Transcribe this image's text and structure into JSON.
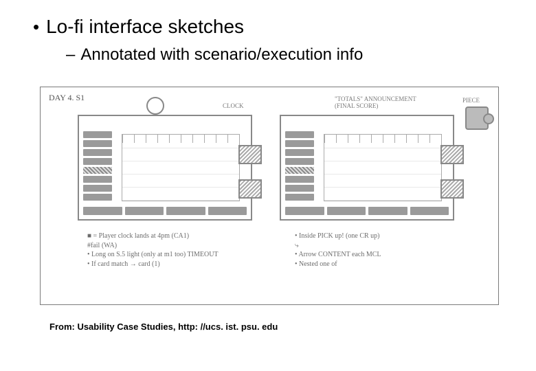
{
  "bullet": {
    "dot": "•",
    "text": "Lo-fi interface sketches"
  },
  "sub": {
    "dash": "–",
    "text": "Annotated with scenario/execution info"
  },
  "figure": {
    "day_label": "DAY 4. S1",
    "annotations": {
      "clock": "CLOCK",
      "totals": "\"TOTALS\" ANNOUNCEMENT\n(FINAL SCORE)",
      "piece": "PIECE"
    },
    "left_notes": "■ = Player clock lands at 4pm (CA1)\n      #fail (WA)\n• Long on S.5 light (only at m1 too)  TIMEOUT\n• If card match → card (1)",
    "right_notes": "• Inside PICK up! (one CR up)\n          ⤷\n• Arrow CONTENT each MCL\n• Nested one of "
  },
  "credit": "From: Usability Case Studies, http: //ucs. ist. psu. edu"
}
